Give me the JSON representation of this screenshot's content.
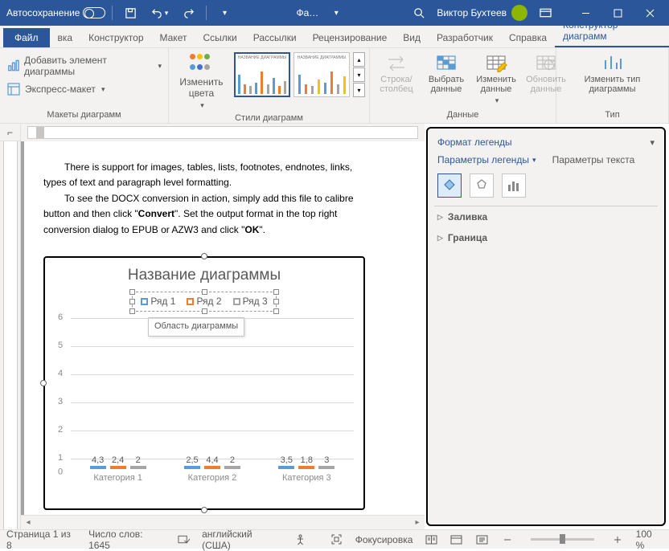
{
  "titlebar": {
    "autosave": "Автосохранение",
    "filename": "Фа…",
    "user": "Виктор Бухтеев"
  },
  "tabs": {
    "file": "Файл",
    "t1": "вка",
    "t2": "Конструктор",
    "t3": "Макет",
    "t4": "Ссылки",
    "t5": "Рассылки",
    "t6": "Рецензирование",
    "t7": "Вид",
    "t8": "Разработчик",
    "t9": "Справка",
    "active": "Конструктор диаграмм"
  },
  "ribbon": {
    "addEl": "Добавить элемент диаграммы",
    "express": "Экспресс-макет",
    "g1": "Макеты диаграмм",
    "colors": "Изменить цвета",
    "g2": "Стили диаграмм",
    "rowcol": "Строка/столбец",
    "selData": "Выбрать данные",
    "editData": "Изменить данные",
    "updData": "Обновить данные",
    "g3": "Данные",
    "chgType": "Изменить тип диаграммы",
    "g4": "Тип"
  },
  "doc": {
    "p1a": "There is support for images, tables, lists, footnotes, endnotes, links,",
    "p1b": "types of text and paragraph level formatting.",
    "p2a": "To see the DOCX conversion in action, simply add this file to calibre",
    "p2b_a": "button and then click \"",
    "p2b_b": "Convert",
    "p2b_c": "\".  Set the output format in the top right",
    "p3a": "conversion dialog to EPUB or AZW3 and click \"",
    "p3b": "OK",
    "p3c": "\"."
  },
  "chart_data": {
    "type": "bar",
    "title": "Название диаграммы",
    "categories": [
      "Категория 1",
      "Категория 2",
      "Категория 3"
    ],
    "series": [
      {
        "name": "Ряд 1",
        "values": [
          4.3,
          2.5,
          3.5
        ],
        "labels": [
          "4,3",
          "2,5",
          "3,5"
        ]
      },
      {
        "name": "Ряд 2",
        "values": [
          2.4,
          4.4,
          1.8
        ],
        "labels": [
          "2,4",
          "4,4",
          "1,8"
        ]
      },
      {
        "name": "Ряд 3",
        "values": [
          2,
          2,
          3
        ],
        "labels": [
          "2",
          "2",
          "3"
        ]
      }
    ],
    "ylim": [
      0,
      6
    ],
    "ystep": 1,
    "tooltip": "Область диаграммы"
  },
  "pane": {
    "title": "Формат легенды",
    "close": "×",
    "tab1": "Параметры легенды",
    "tab2": "Параметры текста",
    "sec1": "Заливка",
    "sec2": "Граница"
  },
  "status": {
    "page": "Страница 1 из 8",
    "words": "Число слов: 1645",
    "lang": "английский (США)",
    "focus": "Фокусировка",
    "zoom": "100 %"
  }
}
